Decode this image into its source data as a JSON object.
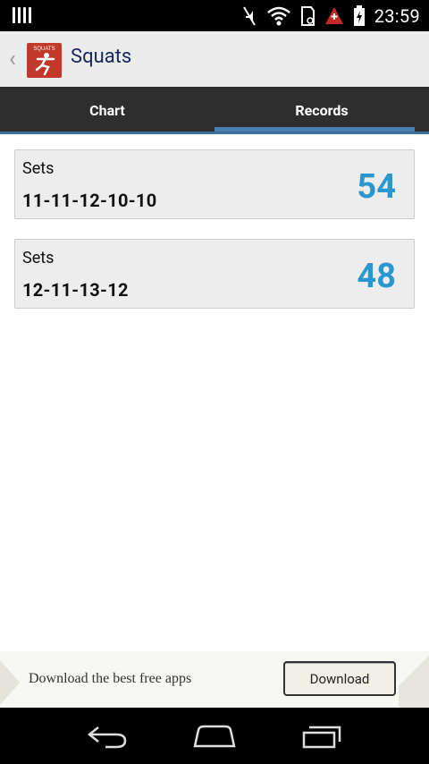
{
  "status_bar": {
    "time": "23:59",
    "icons": [
      "signal-bars-icon",
      "mute-icon",
      "wifi-icon",
      "sd-card-icon",
      "alert-icon",
      "battery-icon"
    ]
  },
  "action_bar": {
    "title": "Squats",
    "app_icon_label": "SQUATS"
  },
  "tabs": [
    {
      "label": "Chart",
      "active": false
    },
    {
      "label": "Records",
      "active": true
    }
  ],
  "records": [
    {
      "label": "Sets",
      "sets": "11-11-12-10-10",
      "total": "54"
    },
    {
      "label": "Sets",
      "sets": "12-11-13-12",
      "total": "48"
    }
  ],
  "ad": {
    "text": "Download the best free apps",
    "button_label": "Download"
  },
  "nav": {
    "buttons": [
      "back-icon",
      "home-icon",
      "recents-icon"
    ]
  },
  "colors": {
    "accent": "#2a97cf",
    "tab_indicator": "#4a7fb0",
    "title": "#17285a"
  }
}
